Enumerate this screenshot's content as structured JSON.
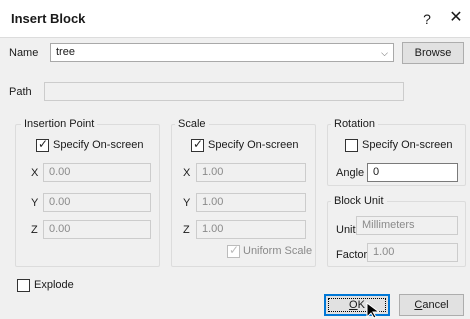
{
  "window": {
    "title": "Insert Block",
    "help": "?",
    "close": "✕"
  },
  "name": {
    "label": "Name",
    "value": "tree",
    "browse": "Browse"
  },
  "path": {
    "label": "Path",
    "value": ""
  },
  "insertion": {
    "title": "Insertion Point",
    "specify": "Specify On-screen",
    "specify_checked": true,
    "x_label": "X",
    "x": "0.00",
    "y_label": "Y",
    "y": "0.00",
    "z_label": "Z",
    "z": "0.00"
  },
  "scale": {
    "title": "Scale",
    "specify": "Specify On-screen",
    "specify_checked": true,
    "x_label": "X",
    "x": "1.00",
    "y_label": "Y",
    "y": "1.00",
    "z_label": "Z",
    "z": "1.00",
    "uniform": "Uniform Scale",
    "uniform_checked": true
  },
  "rotation": {
    "title": "Rotation",
    "specify": "Specify On-screen",
    "specify_checked": false,
    "angle_label": "Angle",
    "angle": "0"
  },
  "block_unit": {
    "title": "Block Unit",
    "unit_label": "Unit",
    "unit": "Millimeters",
    "factor_label": "Factor",
    "factor": "1.00"
  },
  "explode": {
    "label": "Explode",
    "checked": false
  },
  "buttons": {
    "ok_u": "O",
    "ok_rest": "K",
    "cancel_u": "C",
    "cancel_rest": "ancel"
  }
}
